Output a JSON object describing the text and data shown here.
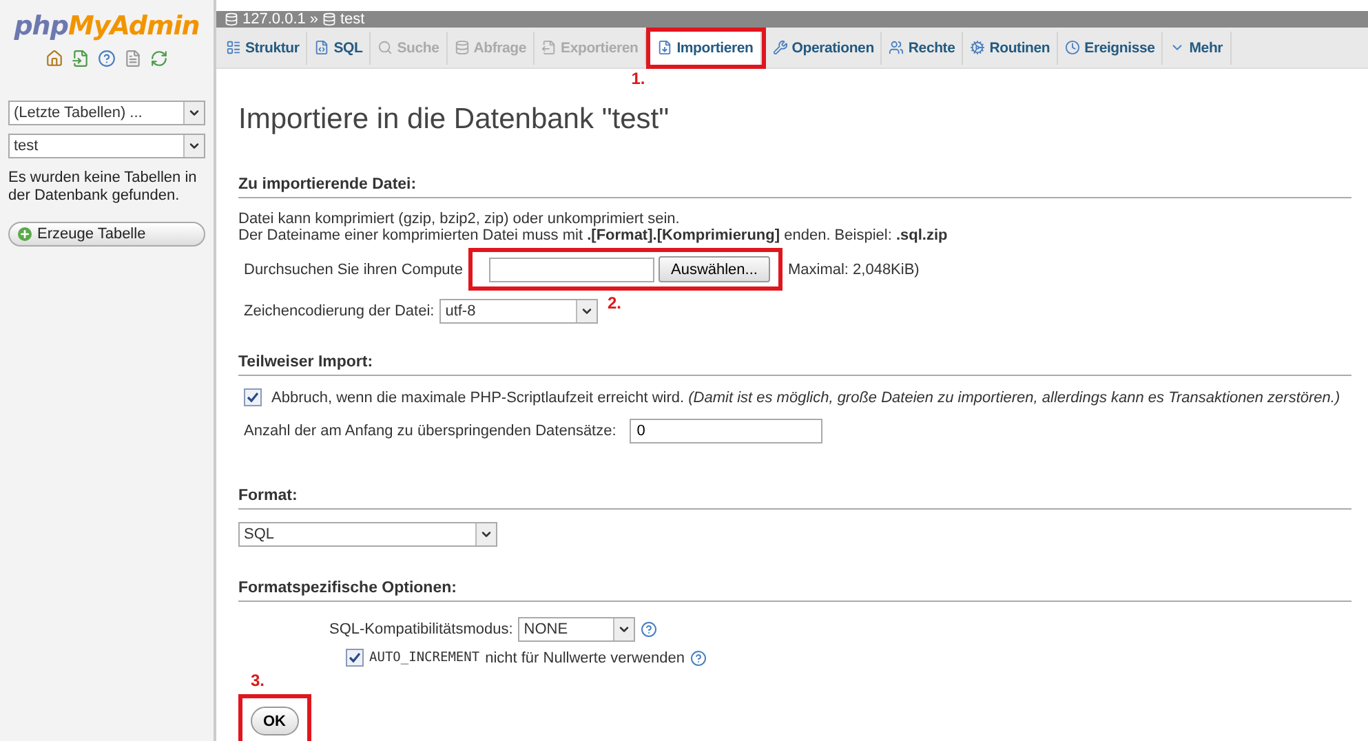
{
  "logo": {
    "part1": "php",
    "part2": "MyAdmin"
  },
  "sidebar": {
    "recent_select": "(Letzte Tabellen) ...",
    "db_select": "test",
    "message": "Es wurden keine Tabellen in der Datenbank gefunden.",
    "create_button": "Erzeuge Tabelle"
  },
  "breadcrumb": {
    "server": "127.0.0.1",
    "separator": "»",
    "database": "test"
  },
  "tabs": [
    {
      "label": "Struktur",
      "selected": false,
      "disabled": false
    },
    {
      "label": "SQL",
      "selected": false,
      "disabled": false
    },
    {
      "label": "Suche",
      "selected": false,
      "disabled": true
    },
    {
      "label": "Abfrage",
      "selected": false,
      "disabled": true
    },
    {
      "label": "Exportieren",
      "selected": false,
      "disabled": true
    },
    {
      "label": "Importieren",
      "selected": true,
      "disabled": false,
      "annotation": "1."
    },
    {
      "label": "Operationen",
      "selected": false,
      "disabled": false
    },
    {
      "label": "Rechte",
      "selected": false,
      "disabled": false
    },
    {
      "label": "Routinen",
      "selected": false,
      "disabled": false
    },
    {
      "label": "Ereignisse",
      "selected": false,
      "disabled": false
    },
    {
      "label": "Mehr",
      "selected": false,
      "disabled": false
    }
  ],
  "heading": "Importiere in die Datenbank \"test\"",
  "file_section": {
    "title": "Zu importierende Datei:",
    "info_1": "Datei kann komprimiert (gzip, bzip2, zip) oder unkomprimiert sein.",
    "info_2": "Der Dateiname einer komprimierten Datei muss mit **.[Format].[Komprimierung]** enden. Beispiel: **.sql.zip**",
    "browse_label": "Durchsuchen Sie ihren Compute",
    "browse_button": "Auswählen...",
    "max_size": "Maximal: 2,048KiB)",
    "annotation": "2.",
    "charset_label": "Zeichencodierung der Datei:",
    "charset": "utf-8"
  },
  "partial_section": {
    "title": "Teilweiser Import:",
    "abort_checked": true,
    "abort_label": "Abbruch, wenn die maximale PHP-Scriptlaufzeit erreicht wird. *(Damit ist es möglich, große Dateien zu importieren, allerdings kann es Transaktionen zerstören.)*",
    "skip_label": "Anzahl der am Anfang zu überspringenden Datensätze:",
    "skip_value": "0"
  },
  "format_section": {
    "title": "Format:",
    "format": "SQL"
  },
  "options_section": {
    "title": "Formatspezifische Optionen:",
    "compat_label": "SQL-Kompatibilitätsmodus:",
    "compat": "NONE",
    "autoinc_checked": true,
    "autoinc_code": "AUTO_INCREMENT",
    "autoinc_label": "nicht für Nullwerte verwenden"
  },
  "submit": {
    "label": "OK",
    "annotation": "3."
  }
}
